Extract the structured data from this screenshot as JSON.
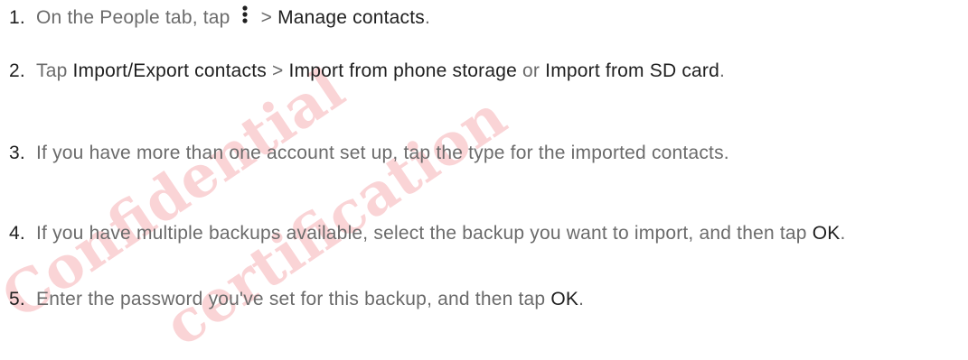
{
  "watermark": {
    "line1": "Confidential",
    "line2": "certification",
    "color": "#e63c46"
  },
  "steps": [
    {
      "num": "1.",
      "a": "On the People tab, tap",
      "icon": "overflow-menu-icon",
      "b": "> ",
      "c": "Manage contacts",
      "d": "."
    },
    {
      "num": "2.",
      "a": "Tap ",
      "b": "Import/Export contacts",
      "c": " > ",
      "d": "Import from phone storage",
      "e": " or ",
      "f": "Import from SD card",
      "g": "."
    },
    {
      "num": "3.",
      "text": "If you have more than one account set up, tap the type for the imported contacts."
    },
    {
      "num": "4.",
      "a": "If you have multiple backups available, select the backup you want to import, and then tap ",
      "b": "OK",
      "c": "."
    },
    {
      "num": "5.",
      "a": "Enter the password you've set for this backup, and then tap ",
      "b": "OK",
      "c": "."
    }
  ]
}
